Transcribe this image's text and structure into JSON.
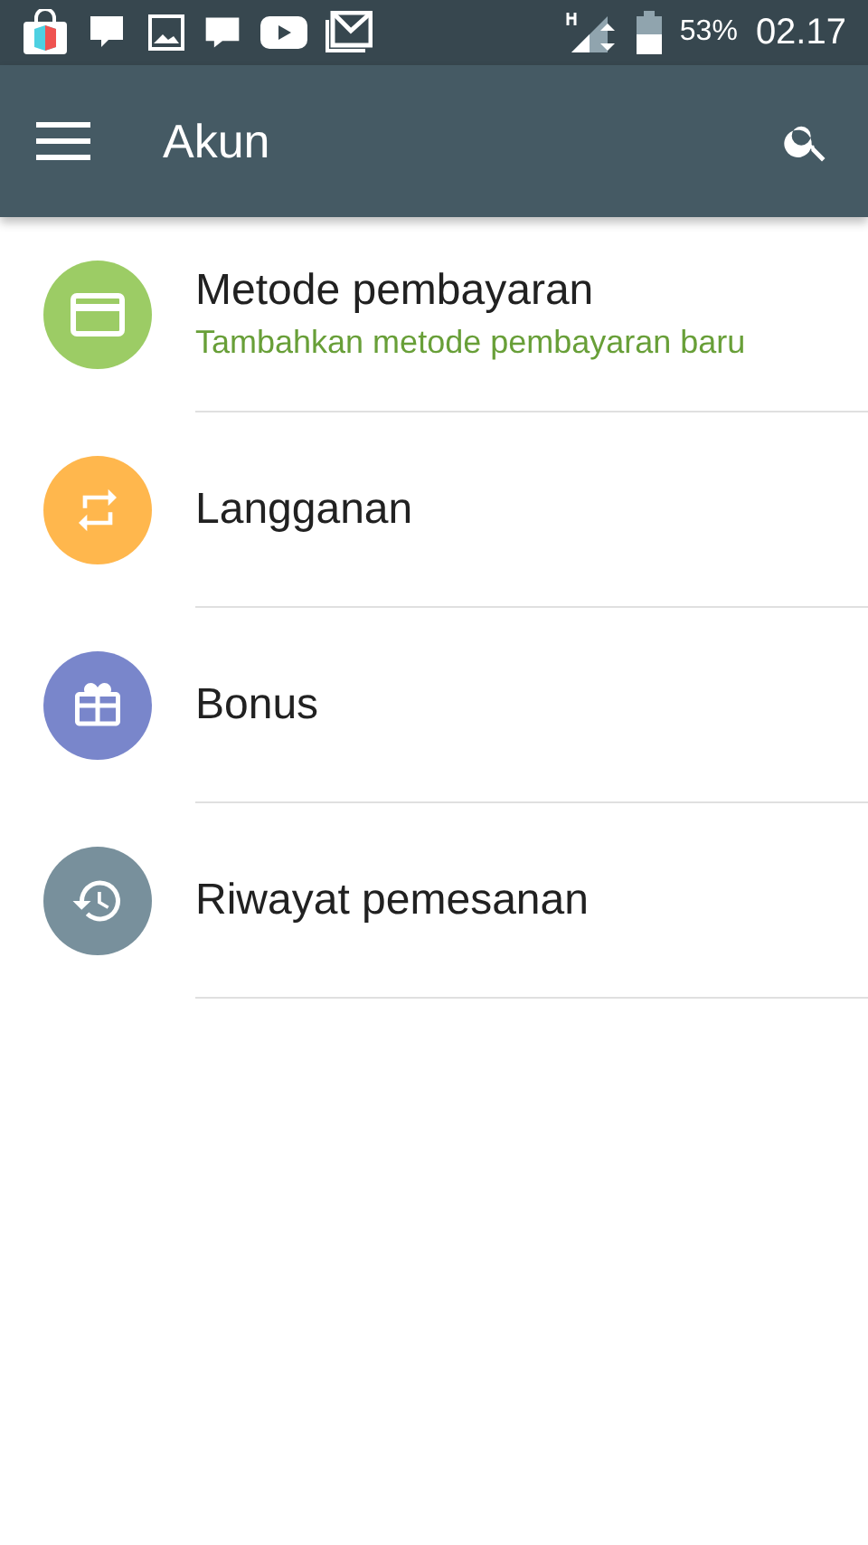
{
  "status_bar": {
    "battery": "53%",
    "time": "02.17"
  },
  "app_bar": {
    "title": "Akun"
  },
  "items": [
    {
      "kind": "card",
      "color": "#9ccc65",
      "title": "Metode pembayaran",
      "subtitle": "Tambahkan metode pembayaran baru"
    },
    {
      "kind": "repeat",
      "color": "#ffb74d",
      "title": "Langganan"
    },
    {
      "kind": "gift",
      "color": "#7986cb",
      "title": "Bonus"
    },
    {
      "kind": "history",
      "color": "#78909c",
      "title": "Riwayat pemesanan"
    }
  ]
}
